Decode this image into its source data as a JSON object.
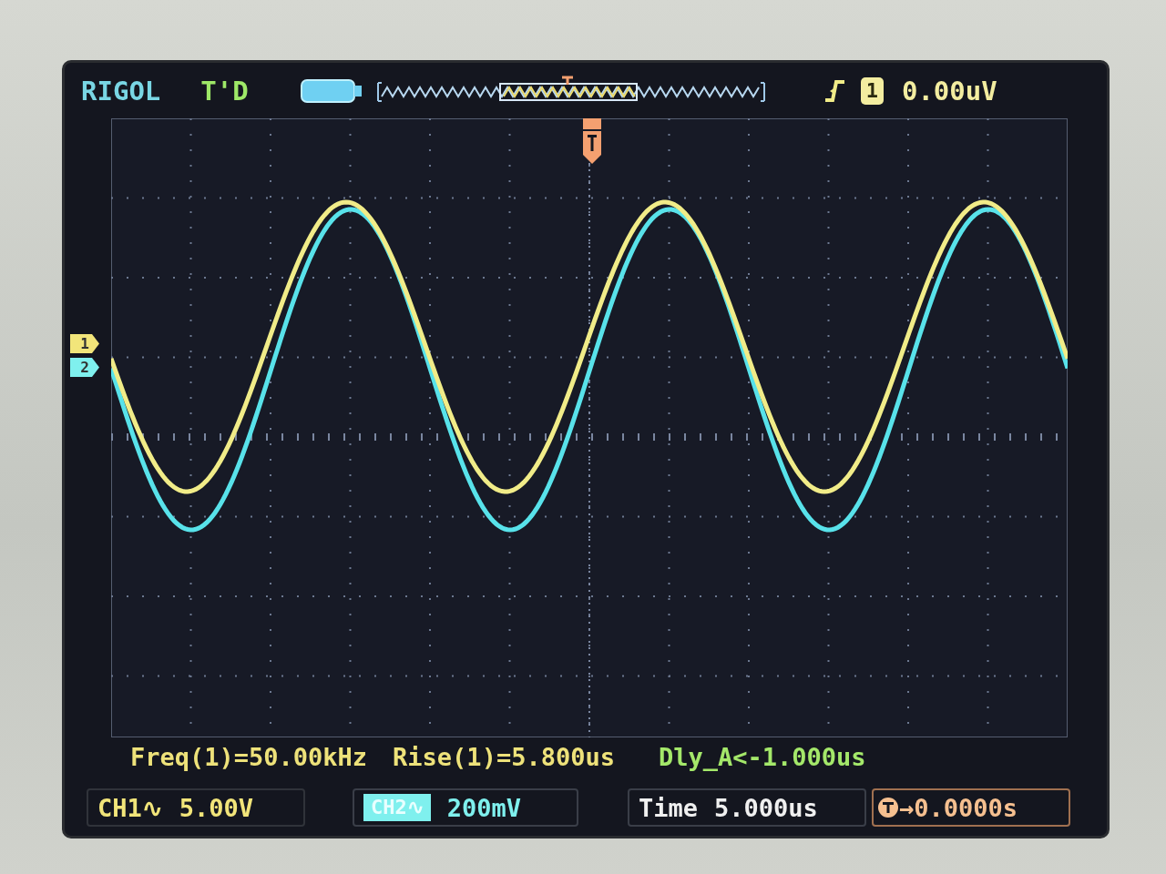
{
  "header": {
    "brand": "RIGOL",
    "run_state": "T'D",
    "trigger_source": "1",
    "trigger_level": "0.00uV"
  },
  "channel_markers": [
    {
      "label": "1",
      "color": "#f2e57a"
    },
    {
      "label": "2",
      "color": "#7ff0ee"
    }
  ],
  "measurements": [
    {
      "text": "Freq(1)=50.00kHz",
      "color": "#eee27a"
    },
    {
      "text": "Rise(1)=5.800us",
      "color": "#eee27a"
    },
    {
      "text": "Dly_A<-1.000us",
      "color": "#a4e86a"
    }
  ],
  "status_bar": [
    {
      "kind": "channel",
      "label": "CH1∿",
      "value": "5.00V",
      "selected": false,
      "color": "#f2e57a"
    },
    {
      "kind": "channel",
      "label": "CH2∿",
      "value": "200mV",
      "selected": true,
      "color": "#7ff0ee"
    },
    {
      "kind": "time",
      "label": "Time",
      "value": "5.000us"
    },
    {
      "kind": "offset",
      "value": "→0.0000s"
    }
  ]
}
